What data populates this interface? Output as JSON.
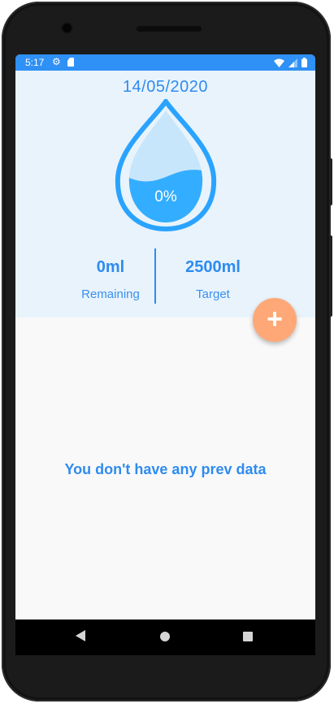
{
  "status_bar": {
    "time": "5:17",
    "color": "#2f90f5",
    "icons": [
      "gear-icon",
      "sd-card-icon",
      "wifi-icon",
      "cellular-signal-icon",
      "battery-icon"
    ]
  },
  "hydration": {
    "date": "14/05/2020",
    "percent_label": "0%",
    "fill_fraction": 0.0,
    "remaining": {
      "value": "0ml",
      "label": "Remaining"
    },
    "target": {
      "value": "2500ml",
      "label": "Target"
    }
  },
  "actions": {
    "add_icon": "plus-icon",
    "add_color": "#ffa877"
  },
  "history": {
    "empty_message": "You don't have any prev data"
  },
  "navigation": {
    "icons": [
      "back-icon",
      "home-icon",
      "recents-icon"
    ]
  },
  "colors": {
    "accent": "#2f8bf0",
    "panel": "#e8f3fb",
    "drop_outline": "#2aa3ff",
    "drop_fill": "#33adff",
    "drop_light": "#c8e6fb"
  }
}
